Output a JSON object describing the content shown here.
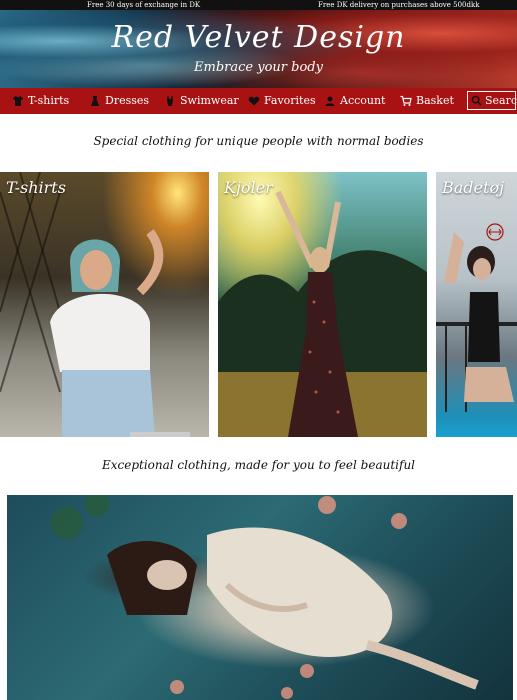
{
  "topbar": {
    "left_text": "Free 30 days of exchange in DK",
    "right_text": "Free DK delivery on purchases above 500dkk"
  },
  "banner": {
    "title": "Red Velvet Design",
    "subtitle": "Embrace your body"
  },
  "nav": {
    "items": [
      {
        "label": "T-shirts",
        "icon": "tshirt-icon"
      },
      {
        "label": "Dresses",
        "icon": "dress-icon"
      },
      {
        "label": "Swimwear",
        "icon": "swimsuit-icon"
      },
      {
        "label": "Favorites",
        "icon": "heart-icon"
      },
      {
        "label": "Account",
        "icon": "user-icon"
      },
      {
        "label": "Basket",
        "icon": "cart-icon"
      }
    ],
    "search_label": "Search"
  },
  "sections": {
    "heading_1": "Special clothing for unique people with normal bodies",
    "heading_2": "Exceptional clothing, made for you to feel beautiful"
  },
  "categories": [
    {
      "label": "T-shirts"
    },
    {
      "label": "Kjoler"
    },
    {
      "label": "Badetøj"
    }
  ],
  "colors": {
    "nav_bg": "#a81212",
    "topbar_bg": "#111111",
    "text_light": "#ffffff"
  }
}
